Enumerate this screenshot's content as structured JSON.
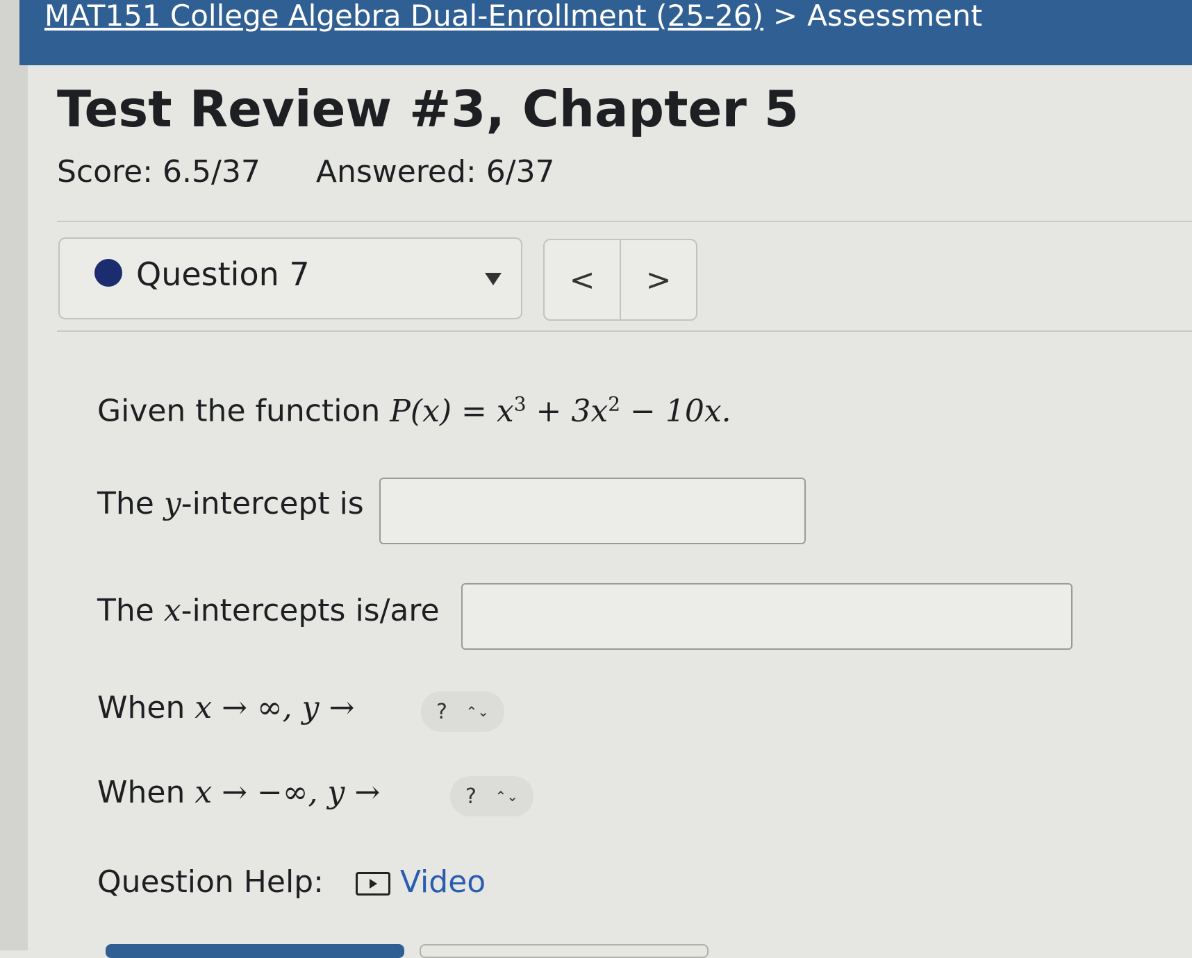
{
  "breadcrumb": {
    "course": "MAT151 College Algebra Dual-Enrollment (25-26)",
    "separator": ">",
    "current": "Assessment"
  },
  "assessment": {
    "title": "Test Review #3, Chapter 5",
    "score_label": "Score: 6.5/37",
    "answered_label": "Answered: 6/37"
  },
  "question_nav": {
    "selected": "Question 7",
    "prev": "<",
    "next": ">"
  },
  "question": {
    "intro": "Given the function",
    "function_name": "P",
    "function_var": "(x) =",
    "term1_base": "x",
    "term1_exp": "3",
    "term2": "+ 3x",
    "term2_exp": "2",
    "term3": "− 10x.",
    "y_intercept_pre": "The",
    "y_intercept_var": "y",
    "y_intercept_post": "-intercept is",
    "x_intercept_pre": "The",
    "x_intercept_var": "x",
    "x_intercept_post": "-intercepts is/are",
    "end1_when": "When",
    "end1_math": "x → ∞, y →",
    "end1_select": "?",
    "end2_when": "When",
    "end2_math": "x → −∞, y →",
    "end2_select": "?",
    "select_arrows": "⌃⌄"
  },
  "help": {
    "label": "Question Help:",
    "video": "Video"
  }
}
